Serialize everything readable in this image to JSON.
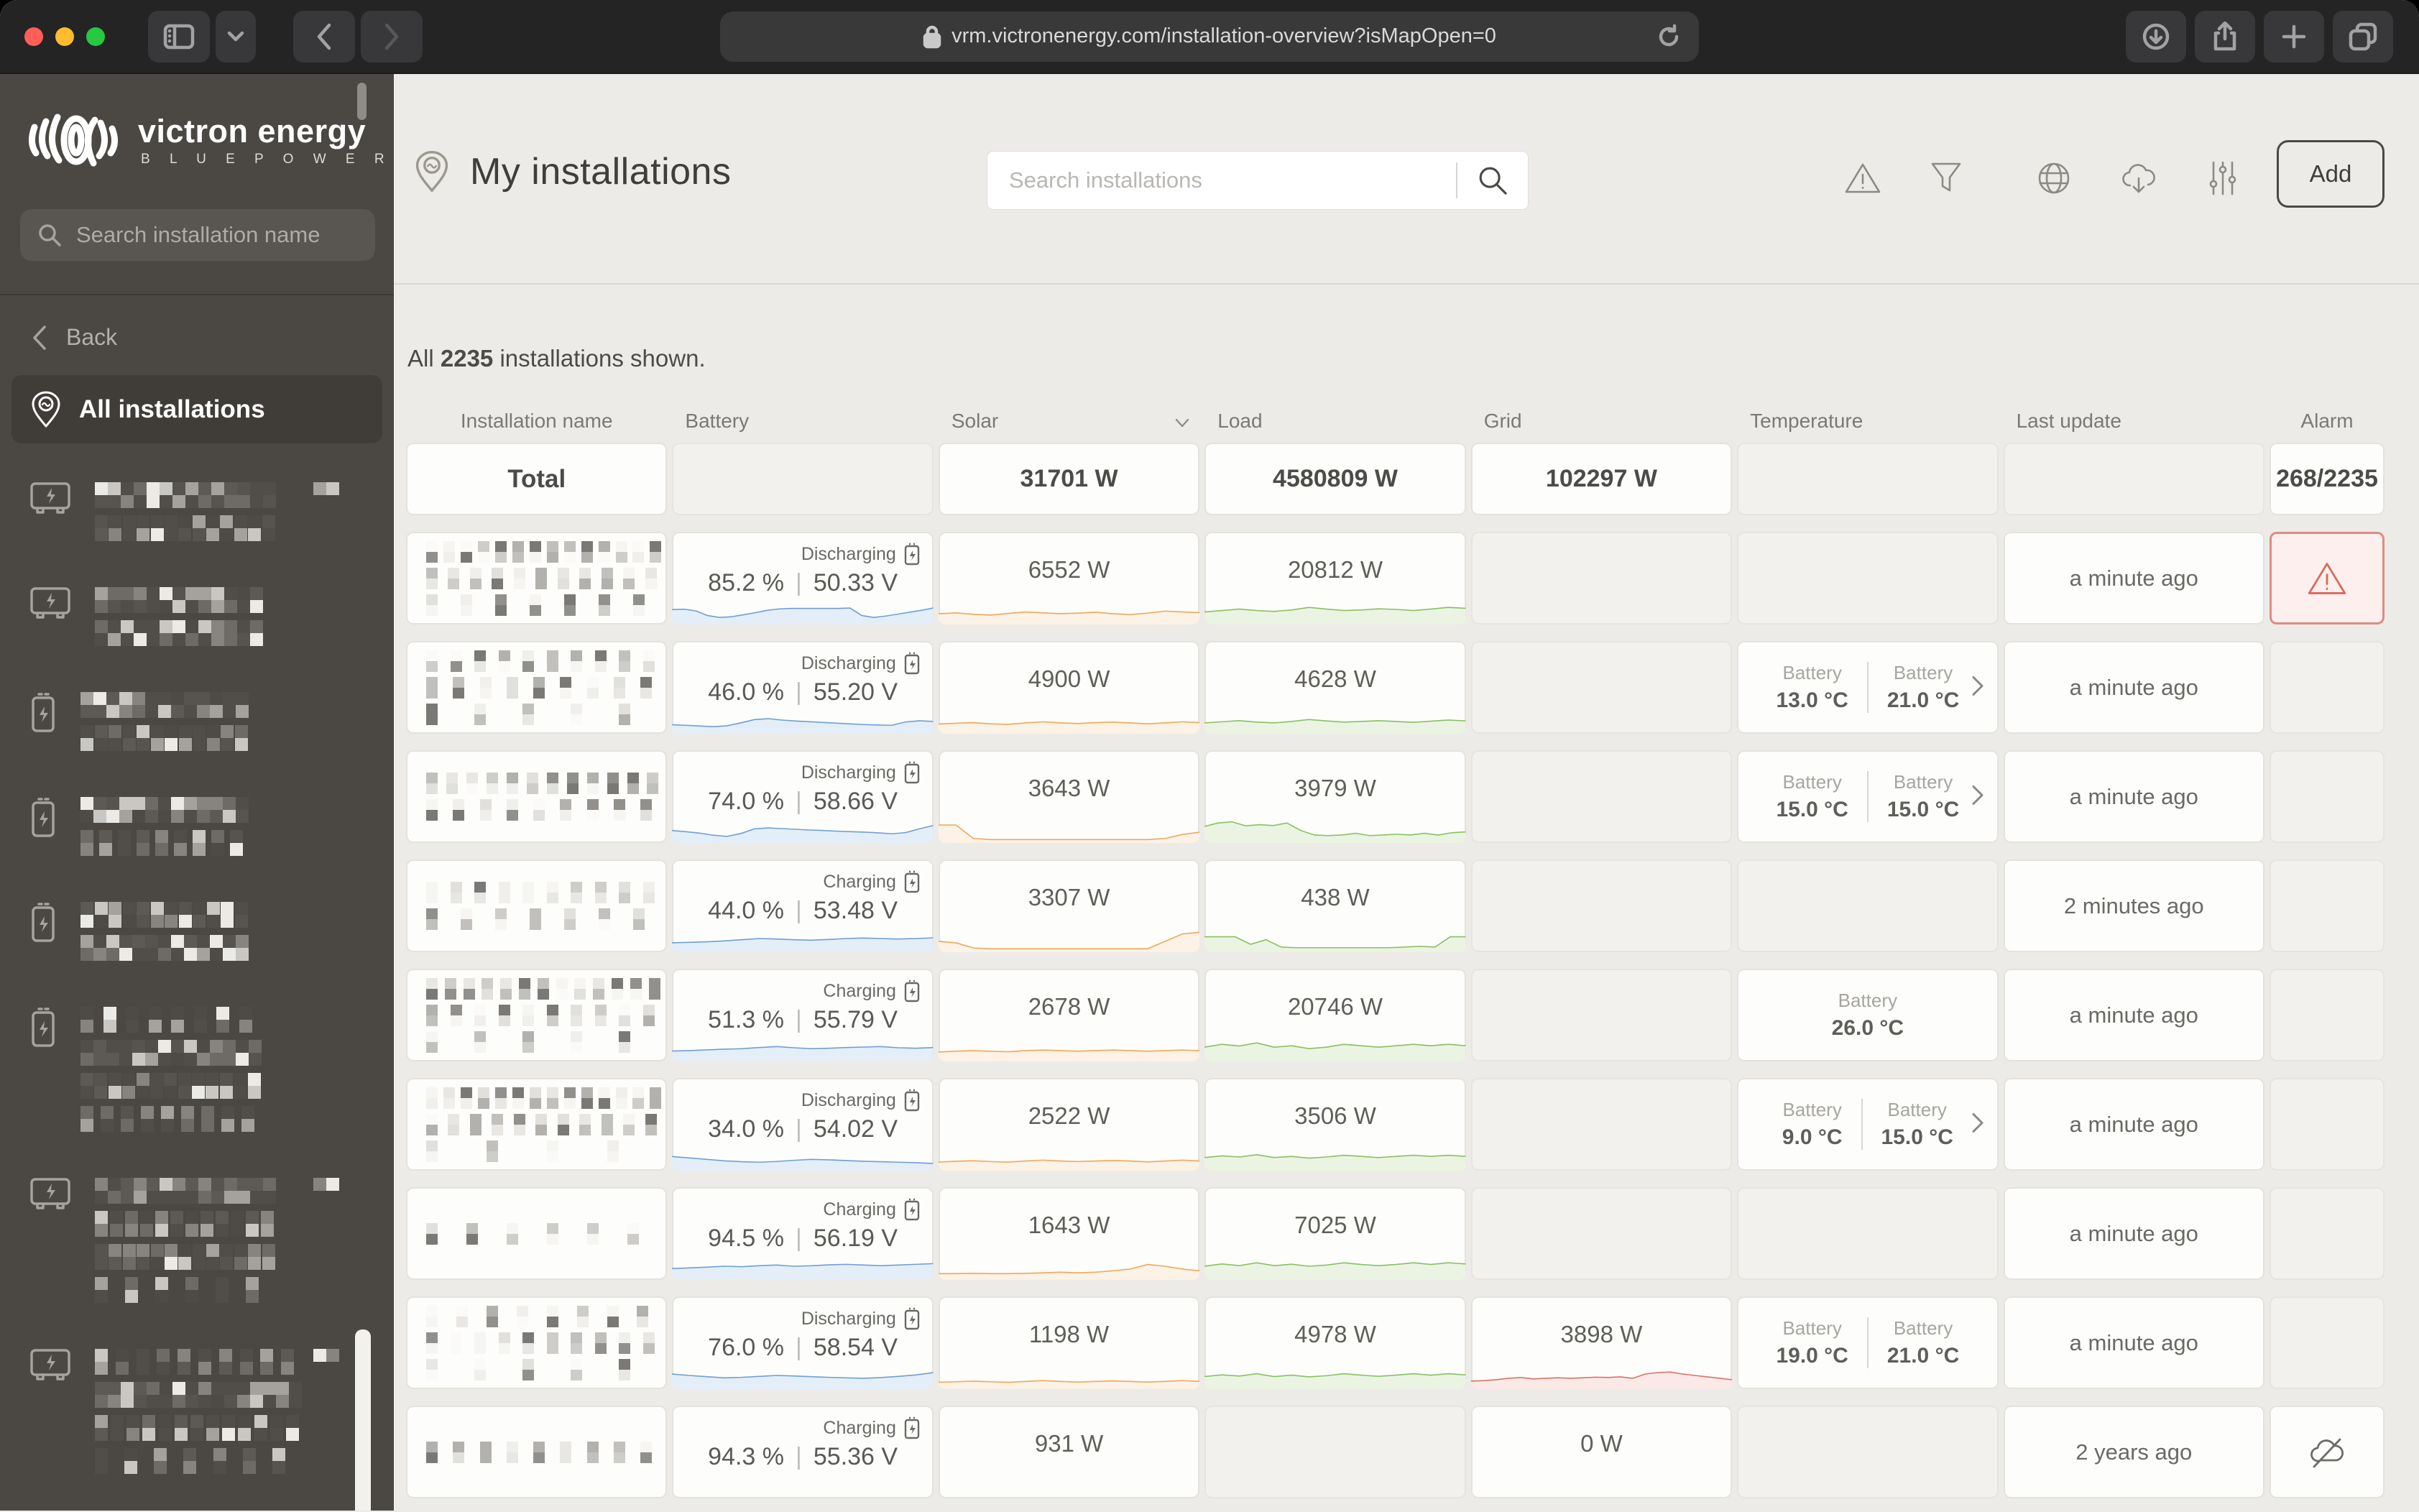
{
  "browser": {
    "url": "vrm.victronenergy.com/installation-overview?isMapOpen=0"
  },
  "brand": {
    "name": "victron energy",
    "tagline": "B L U E   P O W E R"
  },
  "sidebar": {
    "search_placeholder": "Search installation name",
    "back_label": "Back",
    "all_installations_label": "All installations",
    "items": [
      {
        "icon": "inverter-icon",
        "lines": [
          0.82,
          0.78
        ],
        "badge": true
      },
      {
        "icon": "inverter-icon",
        "lines": [
          0.78,
          0.74
        ],
        "badge": false
      },
      {
        "icon": "battery-icon",
        "lines": [
          0.74,
          0.7
        ],
        "badge": false
      },
      {
        "icon": "battery-icon",
        "lines": [
          0.78,
          0.52
        ],
        "badge": false
      },
      {
        "icon": "battery-icon",
        "lines": [
          0.7,
          0.74
        ],
        "badge": false
      },
      {
        "icon": "battery-icon",
        "lines": [
          0.46,
          0.8,
          0.74,
          0.5
        ],
        "badge": false
      },
      {
        "icon": "inverter-icon",
        "lines": [
          0.84,
          0.7,
          0.78,
          0.38
        ],
        "badge": true
      },
      {
        "icon": "inverter-icon",
        "lines": [
          0.6,
          0.92,
          0.74,
          0.4
        ],
        "badge": true
      }
    ]
  },
  "header": {
    "title": "My installations",
    "search_placeholder": "Search installations",
    "add_label": "Add"
  },
  "summary": {
    "prefix": "All",
    "count": "2235",
    "suffix": "installations shown."
  },
  "table": {
    "columns": [
      "Installation name",
      "Battery",
      "Solar",
      "Load",
      "Grid",
      "Temperature",
      "Last update",
      "Alarm"
    ],
    "sorted_column": "Solar",
    "total": {
      "label": "Total",
      "solar": "31701 W",
      "load": "4580809 W",
      "grid": "102297 W",
      "alarm": "268/2235"
    },
    "rows": [
      {
        "name_lines": [
          0.75,
          0.62,
          0.38
        ],
        "battery": {
          "status": "Discharging",
          "soc": "85.2 %",
          "voltage": "50.33 V",
          "spark": [
            55,
            57,
            50,
            30,
            22,
            25,
            33,
            42,
            52,
            58,
            60,
            60,
            60,
            60,
            60,
            62,
            30,
            22,
            28,
            36,
            44,
            52,
            62
          ]
        },
        "solar": {
          "value": "6552 W",
          "spark": [
            30,
            33,
            28,
            25,
            31,
            36,
            33,
            30,
            32,
            35,
            30,
            27,
            32,
            39,
            36,
            34
          ]
        },
        "load": {
          "value": "20812 W",
          "spark": [
            36,
            41,
            46,
            41,
            38,
            43,
            52,
            46,
            41,
            43,
            47,
            45,
            41,
            46,
            52,
            49
          ]
        },
        "grid": null,
        "temperature": null,
        "last_update": "a minute ago",
        "alarm": "warning"
      },
      {
        "name_lines": [
          0.55,
          0.5,
          0.3
        ],
        "battery": {
          "status": "Discharging",
          "soc": "46.0 %",
          "voltage": "55.20 V",
          "spark": [
            30,
            28,
            25,
            22,
            26,
            38,
            52,
            56,
            50,
            46,
            43,
            40,
            37,
            34,
            31,
            29,
            28,
            42,
            47,
            44
          ]
        },
        "solar": {
          "value": "4900 W",
          "spark": [
            26,
            29,
            31,
            27,
            25,
            30,
            34,
            30,
            28,
            31,
            33,
            30,
            27,
            30,
            34,
            31
          ]
        },
        "load": {
          "value": "4628 W",
          "spark": [
            30,
            34,
            38,
            33,
            30,
            35,
            42,
            37,
            33,
            35,
            38,
            35,
            32,
            36,
            40,
            37
          ]
        },
        "grid": null,
        "temperature": {
          "sensors": [
            {
              "label": "Battery",
              "value": "13.0 °C"
            },
            {
              "label": "Battery",
              "value": "21.0 °C"
            }
          ],
          "chevron": true
        },
        "last_update": "a minute ago",
        "alarm": null
      },
      {
        "name_lines": [
          0.65,
          0.5
        ],
        "battery": {
          "status": "Discharging",
          "soc": "74.0 %",
          "voltage": "58.66 V",
          "spark": [
            45,
            40,
            34,
            25,
            20,
            32,
            52,
            56,
            53,
            50,
            47,
            45,
            42,
            40,
            38,
            35,
            31,
            36,
            52,
            66
          ]
        },
        "solar": {
          "value": "3643 W",
          "spark": [
            55,
            55,
            8,
            4,
            4,
            4,
            4,
            4,
            4,
            4,
            4,
            4,
            4,
            8,
            22,
            30
          ]
        },
        "load": {
          "value": "3979 W",
          "spark": [
            50,
            62,
            66,
            52,
            56,
            53,
            62,
            36,
            20,
            18,
            20,
            26,
            18,
            20,
            23,
            20,
            26,
            20,
            28,
            31
          ]
        },
        "grid": null,
        "temperature": {
          "sensors": [
            {
              "label": "Battery",
              "value": "15.0 °C"
            },
            {
              "label": "Battery",
              "value": "15.0 °C"
            }
          ],
          "chevron": true
        },
        "last_update": "a minute ago",
        "alarm": null
      },
      {
        "name_lines": [
          0.55,
          0.4
        ],
        "battery": {
          "status": "Charging",
          "soc": "44.0 %",
          "voltage": "53.48 V",
          "spark": [
            32,
            34,
            36,
            40,
            45,
            50,
            48,
            45,
            43,
            46,
            50,
            52,
            50,
            48,
            50,
            53
          ]
        },
        "solar": {
          "value": "3307 W",
          "spark": [
            30,
            25,
            7,
            4,
            4,
            4,
            4,
            4,
            4,
            4,
            4,
            4,
            4,
            30,
            56,
            62
          ]
        },
        "load": {
          "value": "438 W",
          "spark": [
            46,
            46,
            46,
            20,
            36,
            10,
            8,
            8,
            8,
            8,
            8,
            8,
            8,
            10,
            13,
            10,
            46,
            46
          ]
        },
        "grid": null,
        "temperature": null,
        "last_update": "2 minutes ago",
        "alarm": null
      },
      {
        "name_lines": [
          0.7,
          0.55,
          0.3
        ],
        "battery": {
          "status": "Charging",
          "soc": "51.3 %",
          "voltage": "55.79 V",
          "spark": [
            36,
            38,
            41,
            44,
            46,
            51,
            55,
            50,
            46,
            48,
            51,
            53,
            55,
            50,
            48,
            51
          ]
        },
        "solar": {
          "value": "2678 W",
          "spark": [
            25,
            28,
            30,
            28,
            26,
            30,
            32,
            30,
            28,
            30,
            32,
            30,
            28,
            30,
            32,
            30
          ]
        },
        "load": {
          "value": "20746 W",
          "spark": [
            42,
            52,
            46,
            57,
            42,
            47,
            37,
            42,
            52,
            47,
            42,
            47,
            52,
            47,
            52,
            47
          ]
        },
        "grid": null,
        "temperature": {
          "sensors": [
            {
              "label": "Battery",
              "value": "26.0 °C"
            }
          ],
          "chevron": false
        },
        "last_update": "a minute ago",
        "alarm": null
      },
      {
        "name_lines": [
          0.75,
          0.6,
          0.2
        ],
        "battery": {
          "status": "Discharging",
          "soc": "34.0 %",
          "voltage": "54.02 V",
          "spark": [
            52,
            46,
            40,
            34,
            30,
            28,
            31,
            36,
            40,
            38,
            35,
            32,
            30,
            28,
            26,
            23
          ]
        },
        "solar": {
          "value": "2522 W",
          "spark": [
            22,
            25,
            27,
            24,
            22,
            26,
            29,
            26,
            24,
            26,
            28,
            26,
            23,
            26,
            29,
            26
          ]
        },
        "load": {
          "value": "3506 W",
          "spark": [
            38,
            44,
            40,
            48,
            38,
            42,
            36,
            40,
            46,
            42,
            38,
            42,
            46,
            42,
            46,
            42
          ]
        },
        "grid": null,
        "temperature": {
          "sensors": [
            {
              "label": "Battery",
              "value": "9.0 °C"
            },
            {
              "label": "Battery",
              "value": "15.0 °C"
            }
          ],
          "chevron": true
        },
        "last_update": "a minute ago",
        "alarm": null
      },
      {
        "name_lines": [
          0.35
        ],
        "battery": {
          "status": "Charging",
          "soc": "94.5 %",
          "voltage": "56.19 V",
          "spark": [
            40,
            43,
            46,
            50,
            48,
            52,
            55,
            50,
            52,
            56,
            58,
            55,
            52,
            55,
            58,
            61
          ]
        },
        "solar": {
          "value": "1643 W",
          "spark": [
            14,
            14,
            15,
            14,
            14,
            15,
            17,
            19,
            17,
            19,
            24,
            30,
            46,
            40,
            30,
            24
          ]
        },
        "load": {
          "value": "7025 W",
          "spark": [
            40,
            48,
            42,
            52,
            42,
            47,
            40,
            44,
            52,
            46,
            42,
            46,
            52,
            46,
            52,
            48
          ]
        },
        "grid": null,
        "temperature": null,
        "last_update": "a minute ago",
        "alarm": null
      },
      {
        "name_lines": [
          0.45,
          0.55,
          0.3
        ],
        "battery": {
          "status": "Discharging",
          "soc": "76.0 %",
          "voltage": "58.54 V",
          "spark": [
            56,
            50,
            45,
            40,
            42,
            46,
            50,
            48,
            45,
            42,
            40,
            38,
            41,
            46,
            52,
            62
          ]
        },
        "solar": {
          "value": "1198 W",
          "spark": [
            16,
            18,
            20,
            18,
            16,
            19,
            22,
            19,
            17,
            19,
            21,
            19,
            17,
            19,
            22,
            19
          ]
        },
        "load": {
          "value": "4978 W",
          "spark": [
            36,
            42,
            38,
            46,
            36,
            41,
            35,
            39,
            46,
            41,
            37,
            41,
            46,
            41,
            46,
            42
          ]
        },
        "grid": {
          "value": "3898 W",
          "spark": [
            20,
            22,
            25,
            30,
            33,
            28,
            30,
            32,
            30,
            32,
            34,
            33,
            35,
            30,
            45,
            50,
            52,
            45,
            40,
            35,
            30,
            25
          ]
        },
        "temperature": {
          "sensors": [
            {
              "label": "Battery",
              "value": "19.0 °C"
            },
            {
              "label": "Battery",
              "value": "21.0 °C"
            }
          ],
          "chevron": false
        },
        "last_update": "a minute ago",
        "alarm": null
      },
      {
        "name_lines": [
          0.5
        ],
        "battery": {
          "status": "Charging",
          "soc": "94.3 %",
          "voltage": "55.36 V",
          "spark": null
        },
        "solar": {
          "value": "931 W",
          "spark": null
        },
        "load": null,
        "grid": {
          "value": "0 W",
          "spark": null
        },
        "temperature": null,
        "last_update": "2 years ago",
        "alarm": "offline"
      }
    ]
  },
  "colors": {
    "battery_line": "#6f9fd3",
    "battery_fill": "#e4eef8",
    "solar_line": "#efa759",
    "solar_fill": "#fcf2e5",
    "load_line": "#8abf63",
    "load_fill": "#ebf4e3",
    "grid_line": "#dd7066",
    "grid_fill": "#fbe9e7",
    "alarm_red": "#d9695f"
  }
}
